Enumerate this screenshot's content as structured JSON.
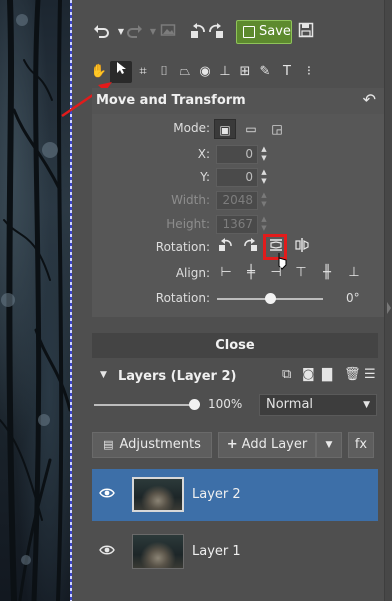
{
  "toolbar": {
    "save_label": "Save"
  },
  "tools": [
    {
      "icon": "hand-icon"
    },
    {
      "icon": "move-arrow-icon"
    },
    {
      "icon": "crop-icon"
    },
    {
      "icon": "straighten-icon"
    },
    {
      "icon": "perspective-icon"
    },
    {
      "icon": "eye-red-eye-icon"
    },
    {
      "icon": "clone-icon"
    },
    {
      "icon": "grid-icon"
    },
    {
      "icon": "brush-icon"
    },
    {
      "icon": "text-icon"
    },
    {
      "icon": "more-icon"
    }
  ],
  "panel": {
    "title": "Move and Transform",
    "mode_label": "Mode:",
    "x_label": "X:",
    "x_value": "0",
    "y_label": "Y:",
    "y_value": "0",
    "width_label": "Width:",
    "width_value": "2048",
    "height_label": "Height:",
    "height_value": "1367",
    "rotation_label": "Rotation:",
    "align_label": "Align:",
    "rotation2_label": "Rotation:",
    "rotation_value": "0°",
    "rotation_slider_fraction": 0.5,
    "close_label": "Close"
  },
  "layers": {
    "title": "Layers (Layer 2)",
    "opacity_value": "100%",
    "opacity_fraction": 1.0,
    "blend_mode": "Normal",
    "adjustments_label": "Adjustments",
    "add_layer_label": "Add Layer",
    "fx_label": "fx",
    "items": [
      {
        "name": "Layer 2",
        "selected": true
      },
      {
        "name": "Layer 1",
        "selected": false
      }
    ]
  },
  "colors": {
    "save_green": "#5d8a2e",
    "selection_blue": "#3d6fa8",
    "highlight_red": "#e21b1b"
  }
}
